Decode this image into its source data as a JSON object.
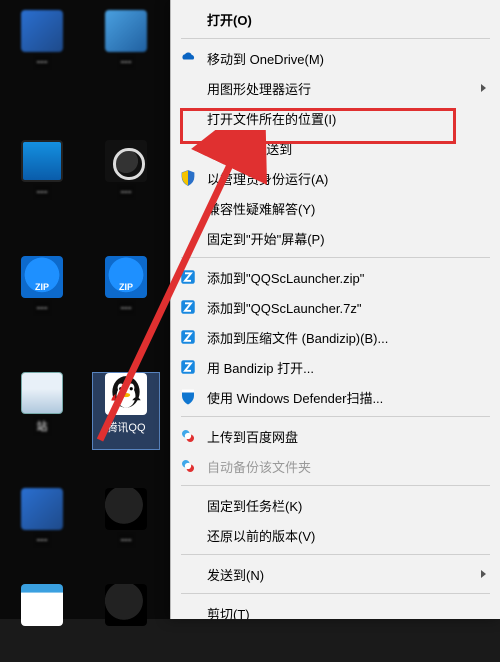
{
  "desktop_icons": {
    "qq_label": "腾讯QQ",
    "recycle_label": "站"
  },
  "menu": {
    "open": "打开(O)",
    "move_onedrive": "移动到 OneDrive(M)",
    "gpu_run": "用图形处理器运行",
    "open_location": "打开文件所在的位置(I)",
    "qq_send": "通过QQ发送到",
    "run_admin": "以管理员身份运行(A)",
    "compat": "兼容性疑难解答(Y)",
    "pin_start": "固定到\"开始\"屏幕(P)",
    "zip1": "添加到\"QQScLauncher.zip\"",
    "zip2": "添加到\"QQScLauncher.7z\"",
    "zip3": "添加到压缩文件 (Bandizip)(B)...",
    "bandizip_open": "用 Bandizip 打开...",
    "defender": "使用 Windows Defender扫描...",
    "baidu_upload": "上传到百度网盘",
    "baidu_backup": "自动备份该文件夹",
    "pin_taskbar": "固定到任务栏(K)",
    "restore": "还原以前的版本(V)",
    "send_to": "发送到(N)",
    "cut": "剪切(T)"
  },
  "colors": {
    "highlight_red": "#e03030",
    "menu_bg": "#f2f2f2"
  }
}
